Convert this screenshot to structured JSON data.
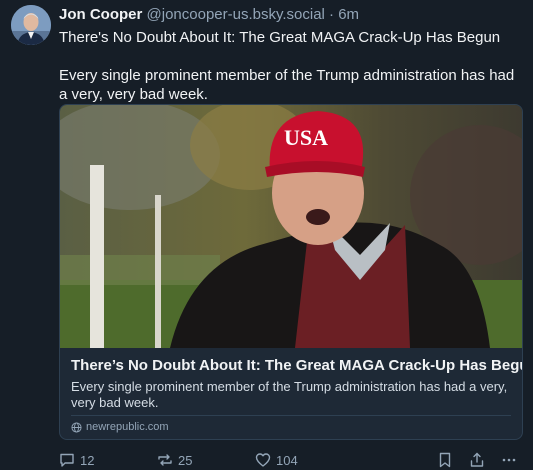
{
  "post": {
    "author_name": "Jon Cooper",
    "handle": "@joncooper-us.bsky.social",
    "separator": "·",
    "time": "6m",
    "text_line1": "There's No Doubt About It: The Great MAGA Crack-Up Has Begun",
    "text_line2": "Every single prominent member of the Trump administration has had a very, very bad week."
  },
  "link_card": {
    "image_text": "USA",
    "title": "There’s No Doubt About It: The Great MAGA Crack-Up Has Begun",
    "description": "Every single prominent member of the Trump administration has had a very, very bad week.",
    "domain": "newrepublic.com"
  },
  "actions": {
    "reply_count": "12",
    "repost_count": "25",
    "like_count": "104"
  },
  "icons": {
    "reply": "speech-bubble-icon",
    "repost": "repost-arrows-icon",
    "like": "heart-icon",
    "bookmark": "bookmark-icon",
    "share": "share-icon",
    "more": "ellipsis-icon",
    "domain": "globe-icon"
  },
  "colors": {
    "background": "#161e27",
    "card_border": "#2e4052",
    "muted_text": "#93a5b7",
    "hat_red": "#c8102e"
  }
}
